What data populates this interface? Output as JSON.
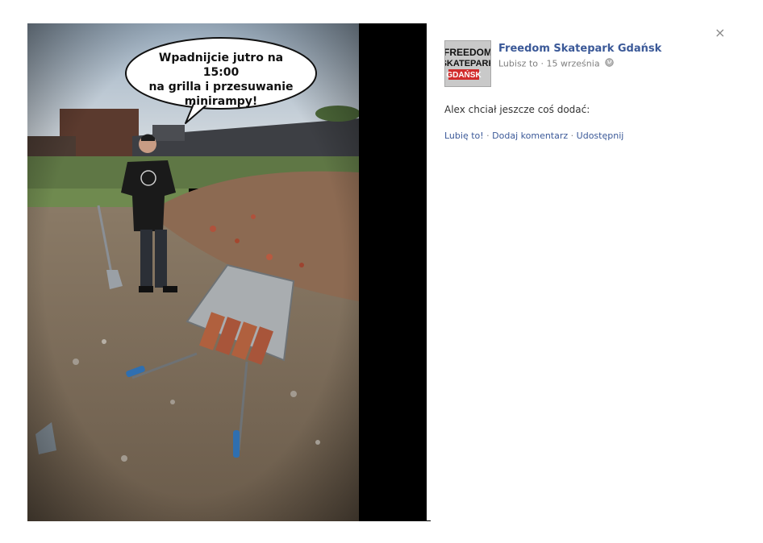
{
  "photo": {
    "bubble_lines": [
      "Wpadnijcie jutro na 15:00",
      "na grilla i przesuwanie",
      "minirampy!"
    ]
  },
  "panel": {
    "close_glyph": "×",
    "page_name": "Freedom Skatepark Gdańsk",
    "avatar_lines": [
      "FREEDOM",
      "SKATEPARK",
      "GDAŃSK"
    ],
    "meta_like": "Lubisz to",
    "meta_sep": "·",
    "meta_date": "15 września",
    "privacy_icon": "globe-icon",
    "post_text": "Alex chciał jeszcze coś dodać:",
    "actions": {
      "like": "Lubię to!",
      "comment": "Dodaj komentarz",
      "share": "Udostępnij",
      "sep": "·"
    }
  },
  "colors": {
    "link": "#3b5998",
    "meta": "#7f7f7f",
    "text": "#333333"
  }
}
